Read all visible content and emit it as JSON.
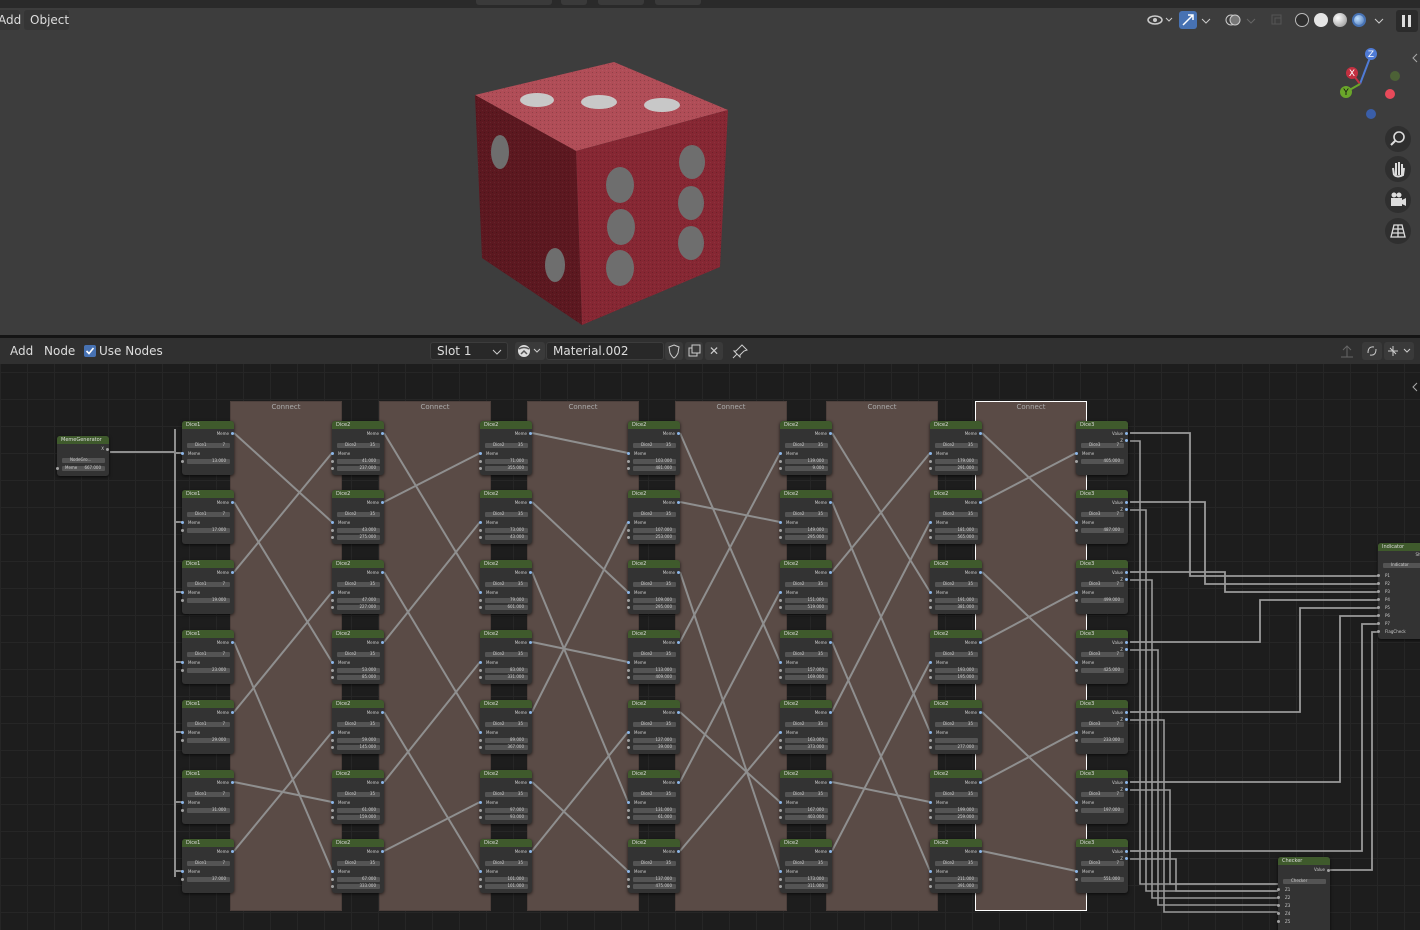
{
  "viewport": {
    "menu_add": "Add",
    "menu_object": "Object",
    "axes": {
      "z": "Z",
      "x": "X",
      "y": "Y"
    },
    "tool_icons": [
      "zoom-icon",
      "hand-icon",
      "camera-icon",
      "grid-icon"
    ],
    "dice_color": "#8b2a33"
  },
  "editor": {
    "menu_add": "Add",
    "menu_node": "Node",
    "use_nodes_label": "Use Nodes",
    "use_nodes_checked": true,
    "slot": "Slot 1",
    "material_name": "Material.002",
    "close_glyph": "✕"
  },
  "frames": {
    "label": "Connect"
  },
  "nodes": {
    "generator": {
      "title": "MemeGenerator",
      "out": "X",
      "group": "NodeGro...",
      "memo_label": "Meme",
      "memo_value": "667.000"
    },
    "col1": {
      "title": "Dice1",
      "out": "Meme",
      "sub": "Dice1",
      "num": "7",
      "in": "Meme",
      "a_label": "A",
      "values": [
        "13.000",
        "17.000",
        "19.000",
        "23.000",
        "29.000",
        "31.000",
        "37.000"
      ]
    },
    "col2": {
      "title": "Dice2",
      "out": "Meme",
      "sub": "Dice2",
      "num": "35",
      "in": "Meme",
      "a": [
        "41.000",
        "43.000",
        "47.000",
        "53.000",
        "59.000",
        "61.000",
        "67.000"
      ],
      "b": [
        "237.000",
        "275.000",
        "227.000",
        "85.000",
        "145.000",
        "159.000",
        "333.000"
      ]
    },
    "col3": {
      "title": "Dice2",
      "out": "Meme",
      "sub": "Dice2",
      "num": "35",
      "in": "Meme",
      "a": [
        "71.000",
        "73.000",
        "79.000",
        "83.000",
        "89.000",
        "97.000",
        "101.000"
      ],
      "b": [
        "355.000",
        "43.000",
        "601.000",
        "331.000",
        "367.000",
        "93.000",
        "101.000"
      ]
    },
    "col4": {
      "title": "Dice2",
      "out": "Meme",
      "sub": "Dice2",
      "num": "35",
      "in": "Meme",
      "a": [
        "103.000",
        "107.000",
        "109.000",
        "113.000",
        "127.000",
        "131.000",
        "137.000"
      ],
      "b": [
        "481.000",
        "253.000",
        "295.000",
        "409.000",
        "39.000",
        "61.000",
        "475.000"
      ]
    },
    "col5": {
      "title": "Dice2",
      "out": "Meme",
      "sub": "Dice2",
      "num": "35",
      "in": "Meme",
      "a": [
        "139.000",
        "149.000",
        "151.000",
        "157.000",
        "163.000",
        "167.000",
        "173.000"
      ],
      "b": [
        "9.000",
        "295.000",
        "519.000",
        "169.000",
        "373.000",
        "403.000",
        "311.000"
      ]
    },
    "col6": {
      "title": "Dice2",
      "out": "Meme",
      "sub": "Dice2",
      "num": "35",
      "in": "Meme",
      "a": [
        "179.000",
        "181.000",
        "191.000",
        "193.000",
        "",
        "199.000",
        "211.000"
      ],
      "b": [
        "291.000",
        "565.000",
        "381.000",
        "195.000",
        "277.000",
        "259.000",
        "391.000"
      ]
    },
    "col7": {
      "title": "Dice3",
      "out": "Value",
      "out2": "Z",
      "sub": "Dice3",
      "num": "7",
      "in": "Meme",
      "a": [
        "405.000",
        "487.000",
        "499.000",
        "425.000",
        "233.000",
        "197.000",
        "551.000"
      ]
    },
    "indicator": {
      "title": "Indicator",
      "out": "Shade",
      "sub": "Indicator",
      "inputs": [
        "P1",
        "P2",
        "P3",
        "P4",
        "P5",
        "P6",
        "P7",
        "FlagCheck"
      ]
    },
    "checker": {
      "title": "Checker",
      "out": "Value",
      "sub": "Checker",
      "inputs": [
        "Z1",
        "Z2",
        "Z3",
        "Z4",
        "Z5"
      ]
    }
  }
}
